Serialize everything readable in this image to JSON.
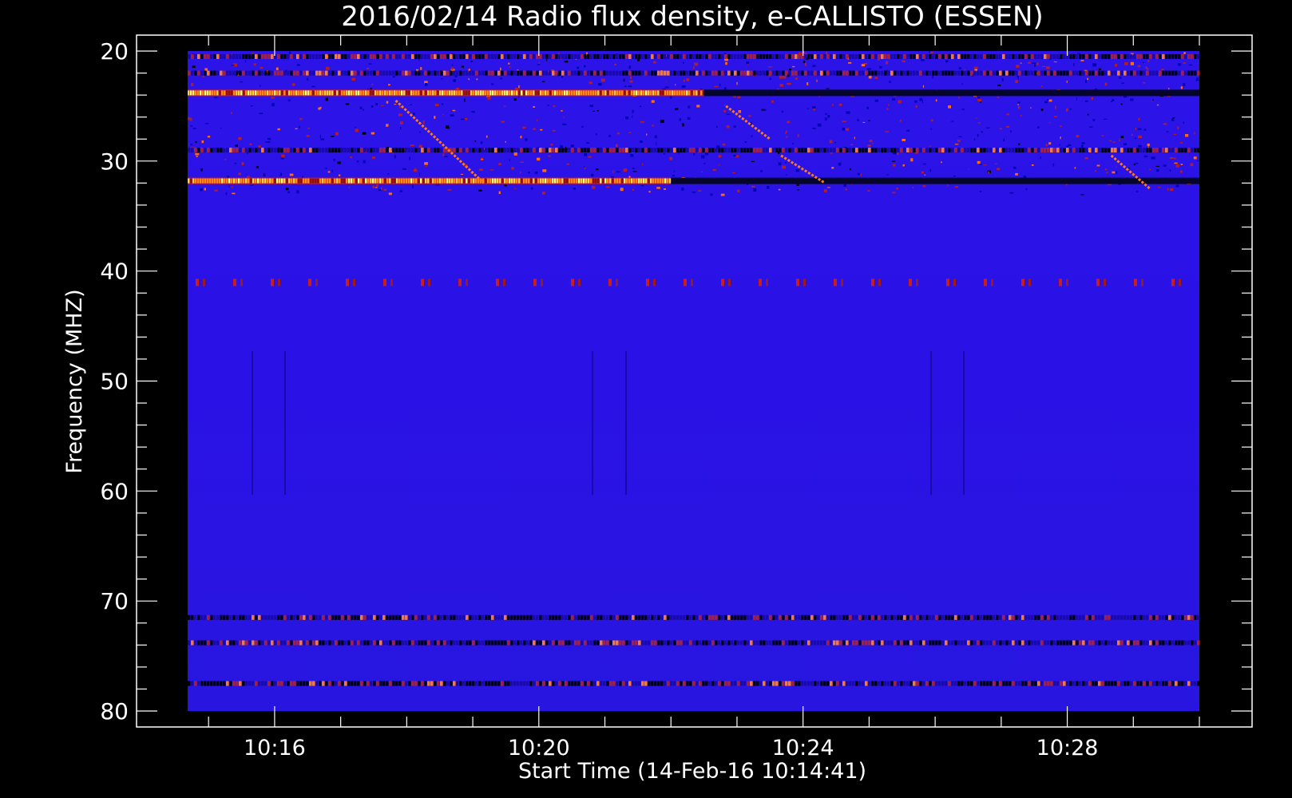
{
  "chart_data": {
    "type": "heatmap",
    "title": "2016/02/14  Radio flux density, e-CALLISTO (ESSEN)",
    "xlabel": "Start Time (14-Feb-16 10:14:41)",
    "ylabel": "Frequency (MHZ)",
    "x_range": [
      "10:14:41",
      "10:30:00"
    ],
    "x_ticks": [
      "10:16",
      "10:20",
      "10:24",
      "10:28"
    ],
    "ylim": [
      80,
      20
    ],
    "y_ticks": [
      20,
      30,
      40,
      50,
      60,
      70,
      80
    ],
    "background_color": "#000000",
    "colormap": [
      "#000000",
      "#0000c8",
      "#3a1fe0",
      "#c81e1e",
      "#ff8a1a",
      "#ffff60"
    ],
    "base_color": "#2a12e6",
    "bands": [
      {
        "freq": 20.5,
        "start": "10:14:41",
        "end": "10:30:00",
        "level": "mixed"
      },
      {
        "freq": 22,
        "start": "10:14:41",
        "end": "10:30:00",
        "level": "mixed"
      },
      {
        "freq": 23.8,
        "start": "10:14:41",
        "end": "10:22:30",
        "level": "high"
      },
      {
        "freq": 23.8,
        "start": "10:22:30",
        "end": "10:30:00",
        "level": "low"
      },
      {
        "freq": 29,
        "start": "10:14:41",
        "end": "10:30:00",
        "level": "mixed"
      },
      {
        "freq": 31.8,
        "start": "10:14:41",
        "end": "10:22:00",
        "level": "high"
      },
      {
        "freq": 31.8,
        "start": "10:22:00",
        "end": "10:30:00",
        "level": "low"
      },
      {
        "freq": 41,
        "start": "10:14:41",
        "end": "10:30:00",
        "level": "dotted"
      },
      {
        "freq": 71.5,
        "start": "10:14:41",
        "end": "10:30:00",
        "level": "mixed"
      },
      {
        "freq": 73.8,
        "start": "10:14:41",
        "end": "10:30:00",
        "level": "mixed"
      },
      {
        "freq": 77.5,
        "start": "10:14:41",
        "end": "10:30:00",
        "level": "mixed"
      }
    ],
    "drifting_features": [
      {
        "start_time": "10:17:50",
        "start_freq": 24.5,
        "end_time": "10:19:10",
        "end_freq": 32
      },
      {
        "start_time": "10:22:50",
        "start_freq": 25,
        "end_time": "10:23:30",
        "end_freq": 28
      },
      {
        "start_time": "10:23:40",
        "start_freq": 29.5,
        "end_time": "10:24:20",
        "end_freq": 32
      },
      {
        "start_time": "10:28:40",
        "start_freq": 29.5,
        "end_time": "10:29:15",
        "end_freq": 32.5
      }
    ]
  }
}
